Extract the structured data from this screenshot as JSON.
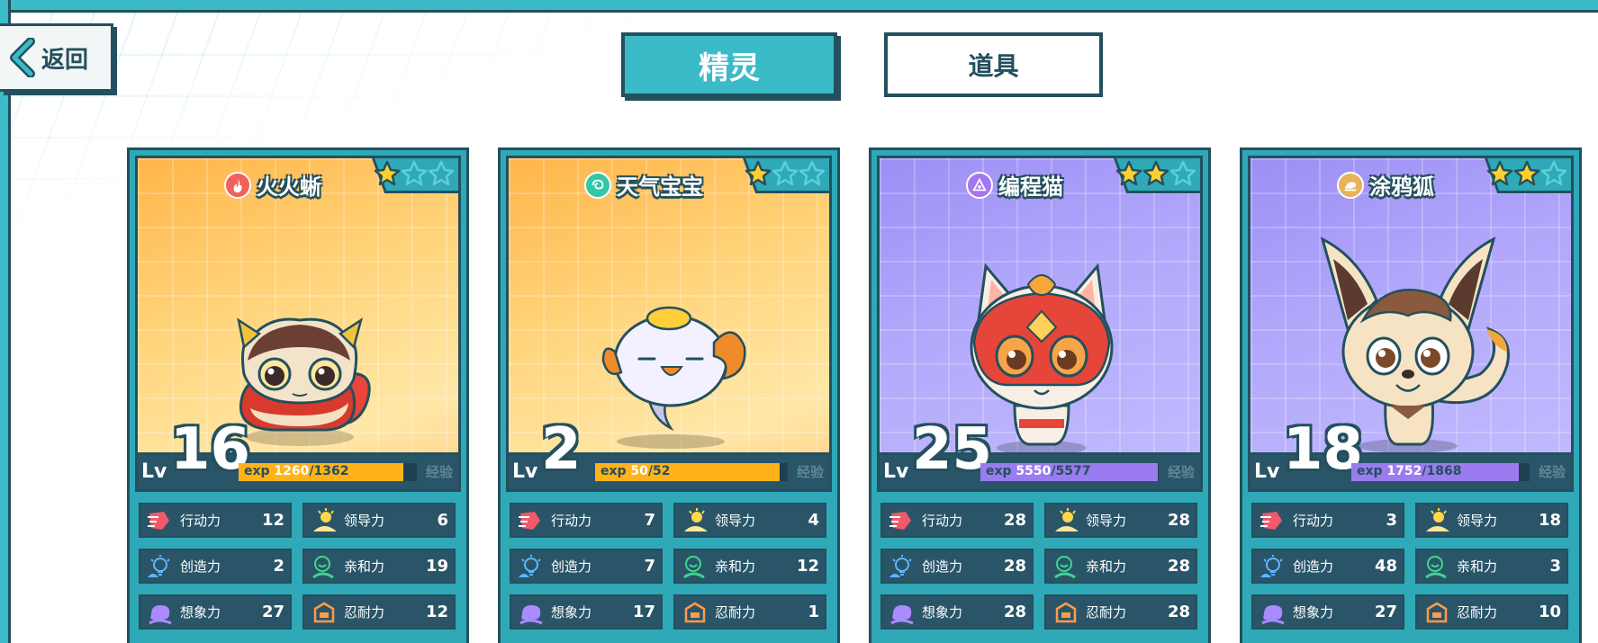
{
  "nav": {
    "back_label": "返回"
  },
  "tabs": [
    {
      "label": "精灵",
      "active": true
    },
    {
      "label": "道具",
      "active": false
    }
  ],
  "colors": {
    "teal": "#3bbac8",
    "dark": "#23505e",
    "exp_orange": "#ffb21a",
    "exp_purple": "#9b7bf0"
  },
  "cards": [
    {
      "name": "火火蜥",
      "element_icon": "fire-icon",
      "stars": 1,
      "max_stars": 3,
      "theme": "orange",
      "level_label": "Lv",
      "level": "16",
      "exp_prefix": "exp",
      "exp_current": "1260",
      "exp_total": "/1362",
      "exp_fraction": 0.925,
      "exp_word": "经验",
      "stats": [
        {
          "name": "行动力",
          "value": "12",
          "icon": "action-icon"
        },
        {
          "name": "领导力",
          "value": "6",
          "icon": "leadership-icon"
        },
        {
          "name": "创造力",
          "value": "2",
          "icon": "creativity-icon"
        },
        {
          "name": "亲和力",
          "value": "19",
          "icon": "affinity-icon"
        },
        {
          "name": "想象力",
          "value": "27",
          "icon": "imagination-icon"
        },
        {
          "name": "忍耐力",
          "value": "12",
          "icon": "endurance-icon"
        }
      ]
    },
    {
      "name": "天气宝宝",
      "element_icon": "weather-icon",
      "stars": 1,
      "max_stars": 3,
      "theme": "orange",
      "level_label": "Lv",
      "level": "2",
      "exp_prefix": "exp",
      "exp_current": "50",
      "exp_total": "/52",
      "exp_fraction": 0.96,
      "exp_word": "经验",
      "stats": [
        {
          "name": "行动力",
          "value": "7",
          "icon": "action-icon"
        },
        {
          "name": "领导力",
          "value": "4",
          "icon": "leadership-icon"
        },
        {
          "name": "创造力",
          "value": "7",
          "icon": "creativity-icon"
        },
        {
          "name": "亲和力",
          "value": "12",
          "icon": "affinity-icon"
        },
        {
          "name": "想象力",
          "value": "17",
          "icon": "imagination-icon"
        },
        {
          "name": "忍耐力",
          "value": "1",
          "icon": "endurance-icon"
        }
      ]
    },
    {
      "name": "编程猫",
      "element_icon": "code-icon",
      "stars": 2,
      "max_stars": 3,
      "theme": "purple",
      "level_label": "Lv",
      "level": "25",
      "exp_prefix": "exp",
      "exp_current": "5550",
      "exp_total": "/5577",
      "exp_fraction": 0.995,
      "exp_word": "经验",
      "stats": [
        {
          "name": "行动力",
          "value": "28",
          "icon": "action-icon"
        },
        {
          "name": "领导力",
          "value": "28",
          "icon": "leadership-icon"
        },
        {
          "name": "创造力",
          "value": "28",
          "icon": "creativity-icon"
        },
        {
          "name": "亲和力",
          "value": "28",
          "icon": "affinity-icon"
        },
        {
          "name": "想象力",
          "value": "28",
          "icon": "imagination-icon"
        },
        {
          "name": "忍耐力",
          "value": "28",
          "icon": "endurance-icon"
        }
      ]
    },
    {
      "name": "涂鸦狐",
      "element_icon": "paint-icon",
      "stars": 2,
      "max_stars": 3,
      "theme": "purple",
      "level_label": "Lv",
      "level": "18",
      "exp_prefix": "exp",
      "exp_current": "1752",
      "exp_total": "/1868",
      "exp_fraction": 0.938,
      "exp_word": "经验",
      "stats": [
        {
          "name": "行动力",
          "value": "3",
          "icon": "action-icon"
        },
        {
          "name": "领导力",
          "value": "18",
          "icon": "leadership-icon"
        },
        {
          "name": "创造力",
          "value": "48",
          "icon": "creativity-icon"
        },
        {
          "name": "亲和力",
          "value": "3",
          "icon": "affinity-icon"
        },
        {
          "name": "想象力",
          "value": "27",
          "icon": "imagination-icon"
        },
        {
          "name": "忍耐力",
          "value": "10",
          "icon": "endurance-icon"
        }
      ]
    }
  ]
}
